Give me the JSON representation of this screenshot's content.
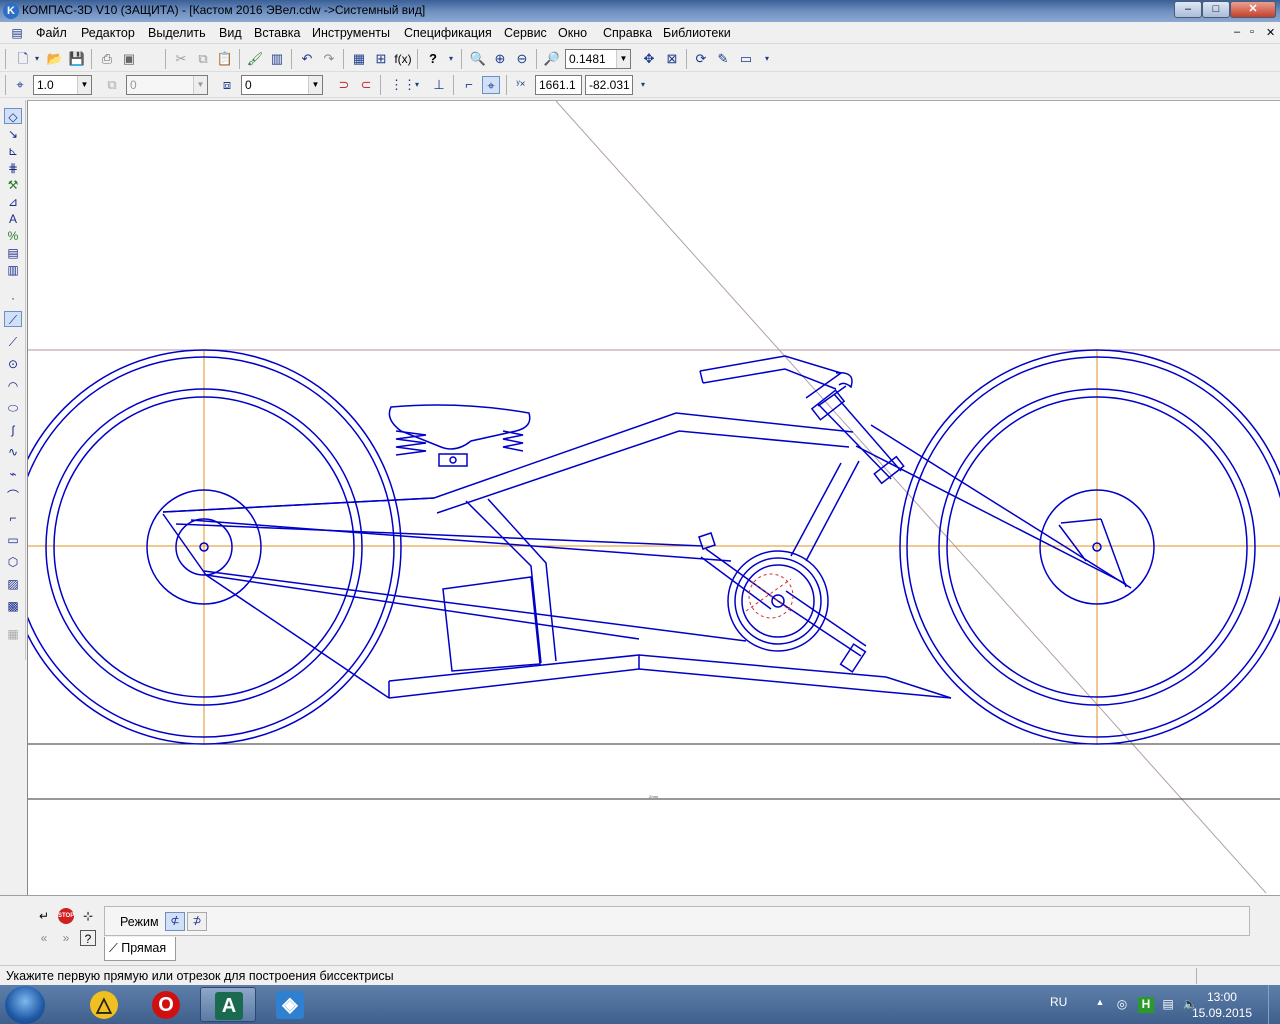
{
  "window": {
    "title": "КОМПАС-3D V10 (ЗАЩИТА) - [Кастом 2016 ЭВел.cdw ->Системный вид]",
    "buttons": {
      "minimize": "–",
      "maximize": "□",
      "close": "✕"
    }
  },
  "menu": [
    {
      "label": "Файл"
    },
    {
      "label": "Редактор"
    },
    {
      "label": "Выделить"
    },
    {
      "label": "Вид"
    },
    {
      "label": "Вставка"
    },
    {
      "label": "Инструменты"
    },
    {
      "label": "Спецификация"
    },
    {
      "label": "Сервис"
    },
    {
      "label": "Окно"
    },
    {
      "label": "Справка"
    },
    {
      "label": "Библиотеки"
    }
  ],
  "mdi_buttons": {
    "minimize": "–",
    "restore": "▫",
    "close": "✕"
  },
  "toolbar1": {
    "zoom_value": "0.1481",
    "fx_label": "f(x)",
    "help_label": "?"
  },
  "toolbar2": {
    "step_value": "1.0",
    "layer_value": "0",
    "style_value": "0",
    "coord_x": "1661.1",
    "coord_y": "-82.031"
  },
  "canvas": {
    "title_block_text": "Zmm"
  },
  "property_bar": {
    "mode_label": "Режим",
    "tab_label": "Прямая"
  },
  "status": {
    "message": "Укажите первую прямую или отрезок для построения биссектрисы"
  },
  "taskbar": {
    "language": "RU",
    "time": "13:00",
    "date": "15.09.2015"
  },
  "colors": {
    "drawing_line": "#0000c8",
    "axis_line": "#e09020",
    "aux_line": "#b090a0",
    "title_bar": "#6d8fc0"
  }
}
